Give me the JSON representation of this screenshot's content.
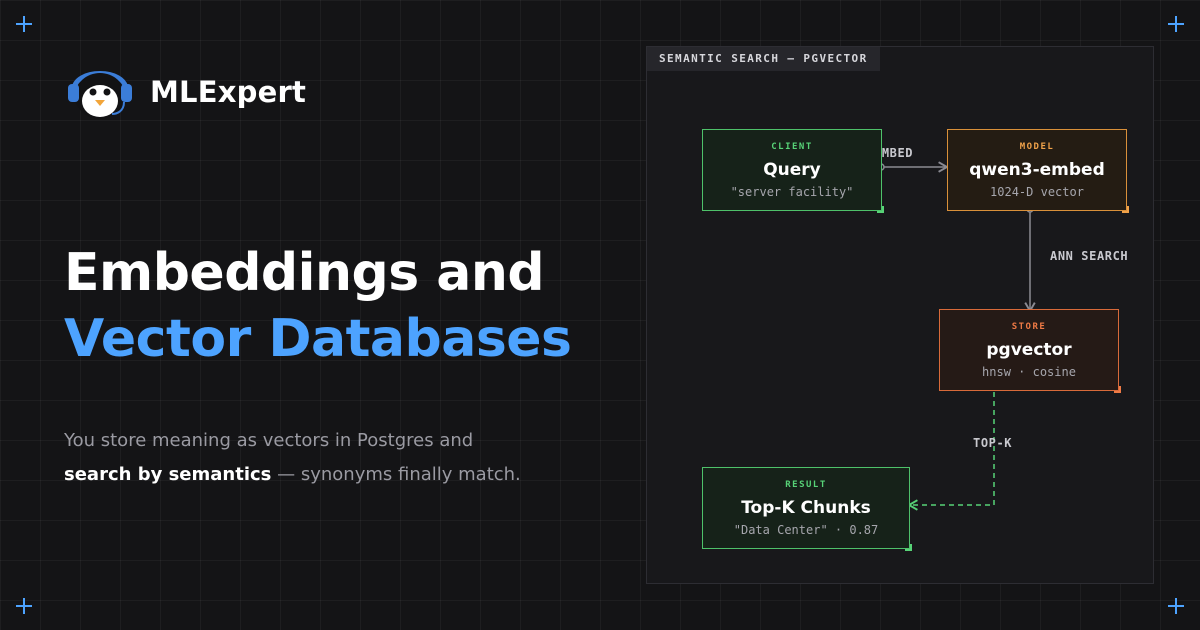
{
  "brand": {
    "name": "MLExpert",
    "logo_icon": "penguin-with-headphones-icon"
  },
  "headline": {
    "line1": "Embeddings and",
    "line2": "Vector Databases"
  },
  "subtitle": {
    "part1": "You store meaning as vectors in Postgres and",
    "strong": "search by semantics",
    "part2": " — synonyms finally match."
  },
  "diagram": {
    "title": "SEMANTIC SEARCH — PGVECTOR",
    "nodes": {
      "client": {
        "kind": "CLIENT",
        "name": "Query",
        "detail": "\"server facility\""
      },
      "model": {
        "kind": "MODEL",
        "name": "qwen3-embed",
        "detail": "1024-D vector"
      },
      "store": {
        "kind": "STORE",
        "name": "pgvector",
        "detail": "hnsw · cosine"
      },
      "result": {
        "kind": "RESULT",
        "name": "Top-K Chunks",
        "detail": "\"Data Center\" · 0.87"
      }
    },
    "edges": {
      "embed": "EMBED",
      "ann_search": "ANN SEARCH",
      "top_k": "TOP-K"
    }
  },
  "colors": {
    "accent": "#4da3ff",
    "client_green": "#57d277",
    "model_amber": "#f0a24a",
    "store_orange": "#ef7a45",
    "edge_gray": "#8a8a92"
  }
}
